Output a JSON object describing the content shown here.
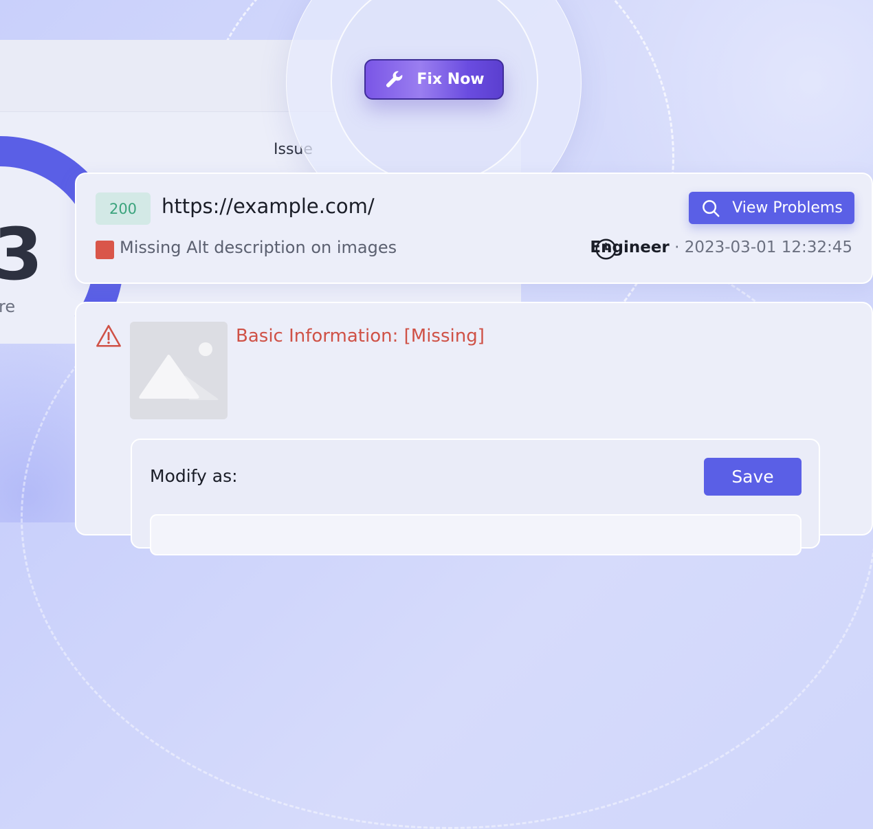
{
  "fix_now": {
    "label": "Fix Now",
    "icon": "wrench-icon"
  },
  "background": {
    "score_value": "3",
    "score_label": "re",
    "issues_label": "Issue"
  },
  "issue_card": {
    "status_code": "200",
    "url": "https://example.com/",
    "issue_text": "Missing Alt description on images",
    "view_problems_label": "View Problems",
    "role": "Engineer",
    "separator": "·",
    "timestamp": "2023-03-01 12:32:45"
  },
  "detail_card": {
    "basic_info": "Basic Information: [Missing]",
    "modify_label": "Modify as:",
    "save_label": "Save"
  },
  "colors": {
    "accent": "#5a5fe6",
    "fix_button": "#7a56e6",
    "status_green": "#3aa37c",
    "error_red": "#d9564a"
  }
}
